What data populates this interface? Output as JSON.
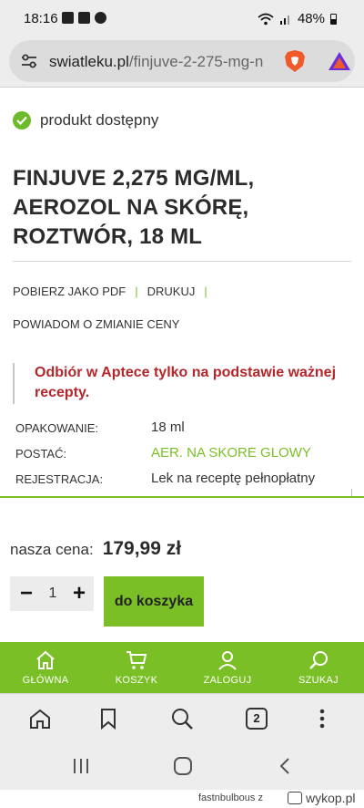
{
  "status_bar": {
    "time": "18:16",
    "battery": "48%",
    "icons": [
      "image-icon",
      "checkbox-icon",
      "messenger-icon",
      "wifi-icon",
      "signal-icon",
      "battery-icon"
    ]
  },
  "browser": {
    "url_host": "swiatleku.pl",
    "url_path": "/finjuve-2-275-mg-n",
    "icons": [
      "site-settings-icon",
      "brave-shield-icon",
      "brave-rewards-icon"
    ]
  },
  "product": {
    "availability": "produkt dostępny",
    "title_lines": [
      "FINJUVE 2,275 MG/ML,",
      "AEROZOL NA SKÓRĘ,",
      "ROZTWÓR, 18 ML"
    ],
    "actions": {
      "pdf": "POBIERZ JAKO PDF",
      "print": "DRUKUJ",
      "price_alert": "POWIADOM O ZMIANIE CENY",
      "separator": "|"
    },
    "notice_lines": [
      "Odbiór w Aptece tylko na podstawie ważnej",
      "recepty."
    ],
    "specs": [
      {
        "label": "OPAKOWANIE:",
        "value": "18 ml"
      },
      {
        "label": "POSTAĆ:",
        "value": "AER. NA SKORE GLOWY"
      },
      {
        "label": "REJESTRACJA:",
        "value": "Lek na receptę pełnopłatny"
      }
    ],
    "price_label": "nasza cena:",
    "price": "179,99 zł",
    "quantity": "1",
    "qty_minus": "−",
    "qty_plus": "+",
    "add_to_cart": "do koszyka"
  },
  "site_nav": [
    {
      "label": "GŁÓWNA",
      "icon": "home-icon"
    },
    {
      "label": "KOSZYK",
      "icon": "cart-icon"
    },
    {
      "label": "ZALOGUJ",
      "icon": "user-icon"
    },
    {
      "label": "SZUKAJ",
      "icon": "search-icon"
    }
  ],
  "browser_toolbar": {
    "tab_count": "2",
    "icons": [
      "home-icon",
      "bookmark-icon",
      "search-icon",
      "tabs-icon",
      "menu-icon"
    ]
  },
  "watermark": {
    "user": "fastnbulbous",
    "separator": "z",
    "brand": "wykop.pl"
  },
  "colors": {
    "accent_green": "#7bbf27",
    "warning_red": "#b3262a",
    "text_dark": "#2b2b2b"
  }
}
